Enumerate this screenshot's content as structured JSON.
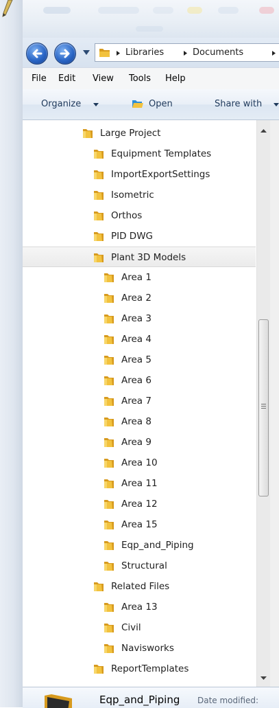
{
  "address": {
    "crumbs": [
      "Libraries",
      "Documents"
    ]
  },
  "menu": {
    "items": [
      "File",
      "Edit",
      "View",
      "Tools",
      "Help"
    ]
  },
  "commands": {
    "organize": "Organize",
    "open": "Open",
    "share": "Share with"
  },
  "tree": {
    "items": [
      {
        "label": "Large Project",
        "level": 0
      },
      {
        "label": "Equipment Templates",
        "level": 1
      },
      {
        "label": "ImportExportSettings",
        "level": 1
      },
      {
        "label": "Isometric",
        "level": 1
      },
      {
        "label": "Orthos",
        "level": 1
      },
      {
        "label": "PID DWG",
        "level": 1
      },
      {
        "label": "Plant 3D Models",
        "level": 1,
        "selected": true
      },
      {
        "label": "Area 1",
        "level": 2
      },
      {
        "label": "Area 2",
        "level": 2
      },
      {
        "label": "Area 3",
        "level": 2
      },
      {
        "label": "Area 4",
        "level": 2
      },
      {
        "label": "Area 5",
        "level": 2
      },
      {
        "label": "Area 6",
        "level": 2
      },
      {
        "label": "Area 7",
        "level": 2
      },
      {
        "label": "Area 8",
        "level": 2
      },
      {
        "label": "Area 9",
        "level": 2
      },
      {
        "label": "Area 10",
        "level": 2
      },
      {
        "label": "Area 11",
        "level": 2
      },
      {
        "label": "Area 12",
        "level": 2
      },
      {
        "label": "Area 15",
        "level": 2
      },
      {
        "label": "Eqp_and_Piping",
        "level": 2
      },
      {
        "label": "Structural",
        "level": 2
      },
      {
        "label": "Related Files",
        "level": 1
      },
      {
        "label": "Area 13",
        "level": 2
      },
      {
        "label": "Civil",
        "level": 2
      },
      {
        "label": "Navisworks",
        "level": 2
      },
      {
        "label": "ReportTemplates",
        "level": 1
      }
    ]
  },
  "details": {
    "name": "Eqp_and_Piping",
    "meta": "Date modified:"
  },
  "colors": {
    "folder_front": "#f2c23e",
    "folder_back": "#d79a1e",
    "nav_button": "#2a66c6"
  }
}
